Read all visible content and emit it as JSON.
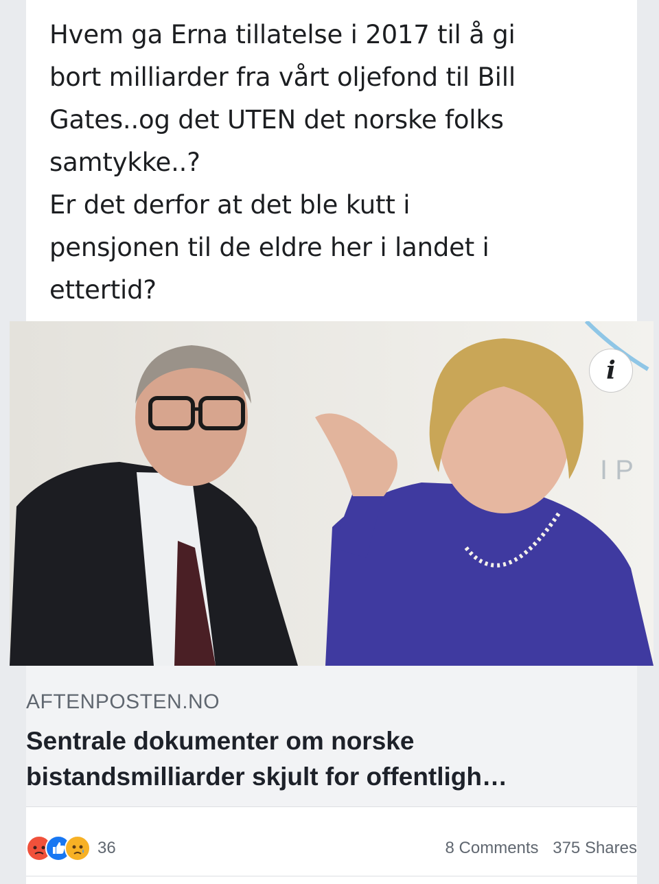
{
  "post": {
    "text_lines": [
      "Hvem ga Erna tillatelse i 2017 til å gi",
      "bort milliarder fra vårt oljefond til Bill",
      "Gates..og det UTEN det norske folks",
      "samtykke..?",
      "Er det derfor at det ble kutt i",
      "pensjonen til de eldre her i landet i",
      "ettertid?"
    ]
  },
  "link": {
    "info_label": "i",
    "domain": "AFTENPOSTEN.NO",
    "title_lines": [
      "Sentrale dokumenter om norske",
      "bistandsmilliarder skjult for offentligh…"
    ]
  },
  "footer": {
    "reaction_icons": [
      "angry-reaction-icon",
      "like-reaction-icon",
      "sad-reaction-icon"
    ],
    "reaction_count": "36",
    "comments": "8 Comments",
    "shares": "375 Shares"
  },
  "colors": {
    "angry": "#f0513b",
    "like": "#1877f2",
    "sad": "#f7b125",
    "text": "#1c1e21",
    "muted": "#606770"
  }
}
